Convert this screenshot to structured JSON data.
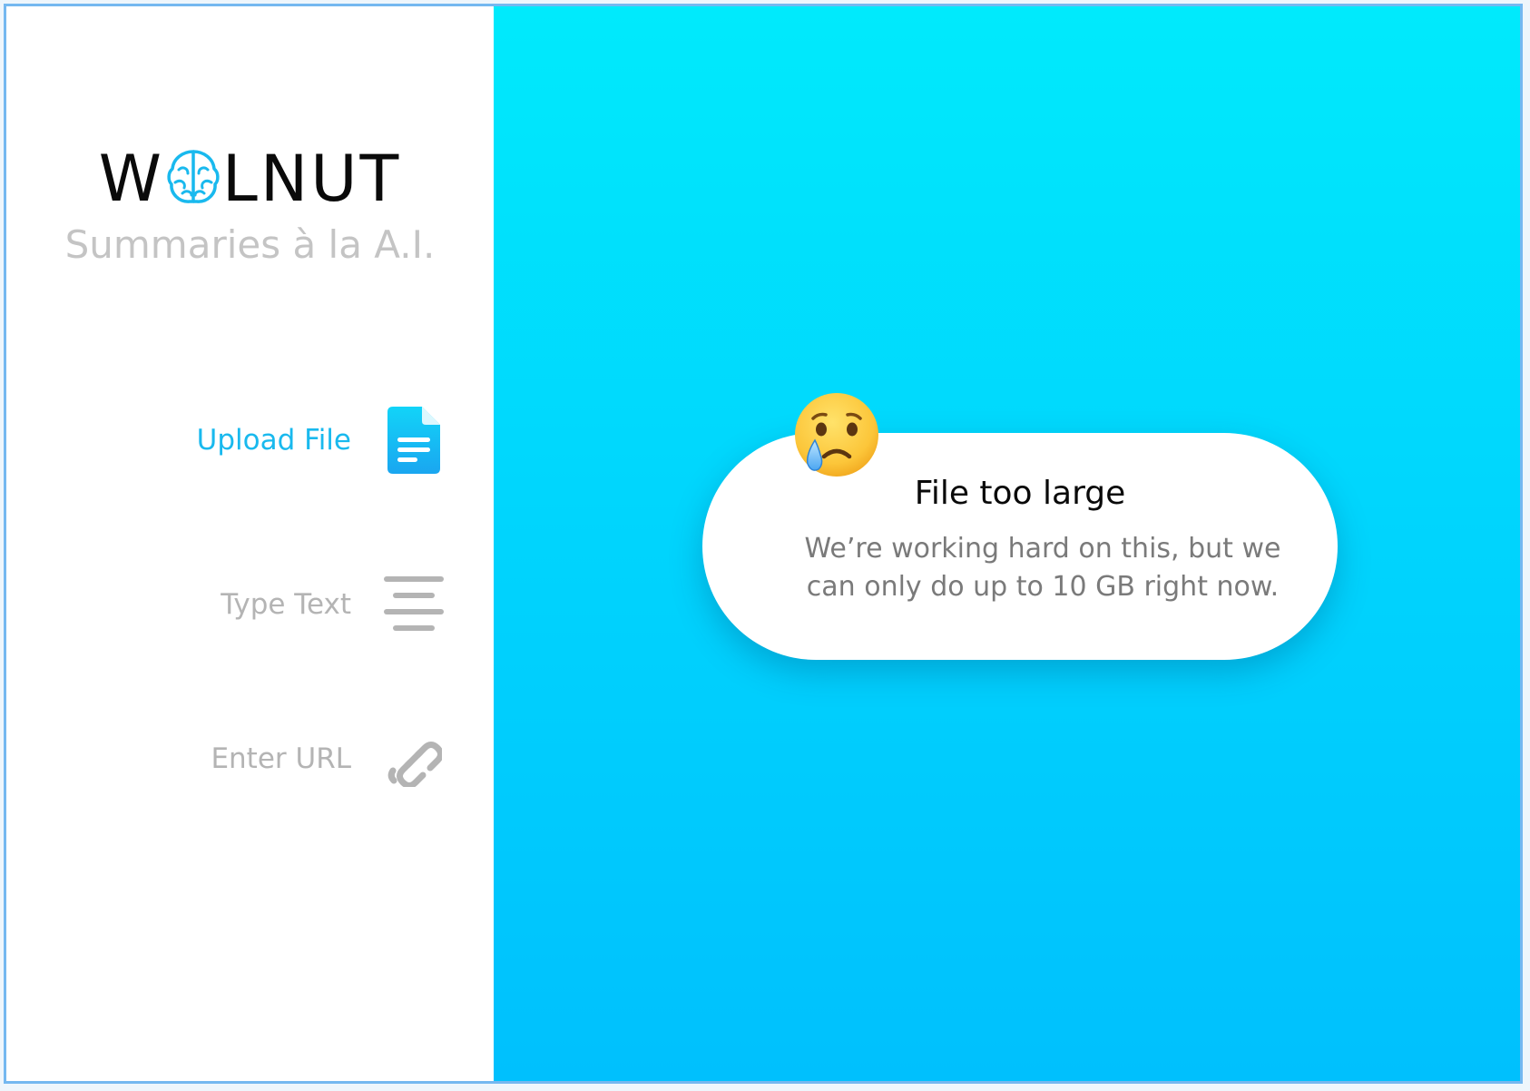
{
  "brand": {
    "logo_left": "W",
    "logo_right": "LNUT",
    "tagline": "Summaries à la A.I."
  },
  "nav": {
    "items": [
      {
        "label": "Upload File",
        "icon": "document-icon",
        "state": "active"
      },
      {
        "label": "Type Text",
        "icon": "align-center-icon",
        "state": "inactive"
      },
      {
        "label": "Enter URL",
        "icon": "link-icon",
        "state": "inactive"
      }
    ]
  },
  "toast": {
    "emoji": "crying-face-icon",
    "title": "File too large",
    "message": "We’re working hard on this, but we can only do up to 10 GB right now."
  },
  "colors": {
    "accent": "#19b9ee",
    "inactive": "#b4b4b4",
    "gradient_top": "#00eafc",
    "gradient_bottom": "#00c0fd",
    "window_border": "#74b8f0"
  }
}
